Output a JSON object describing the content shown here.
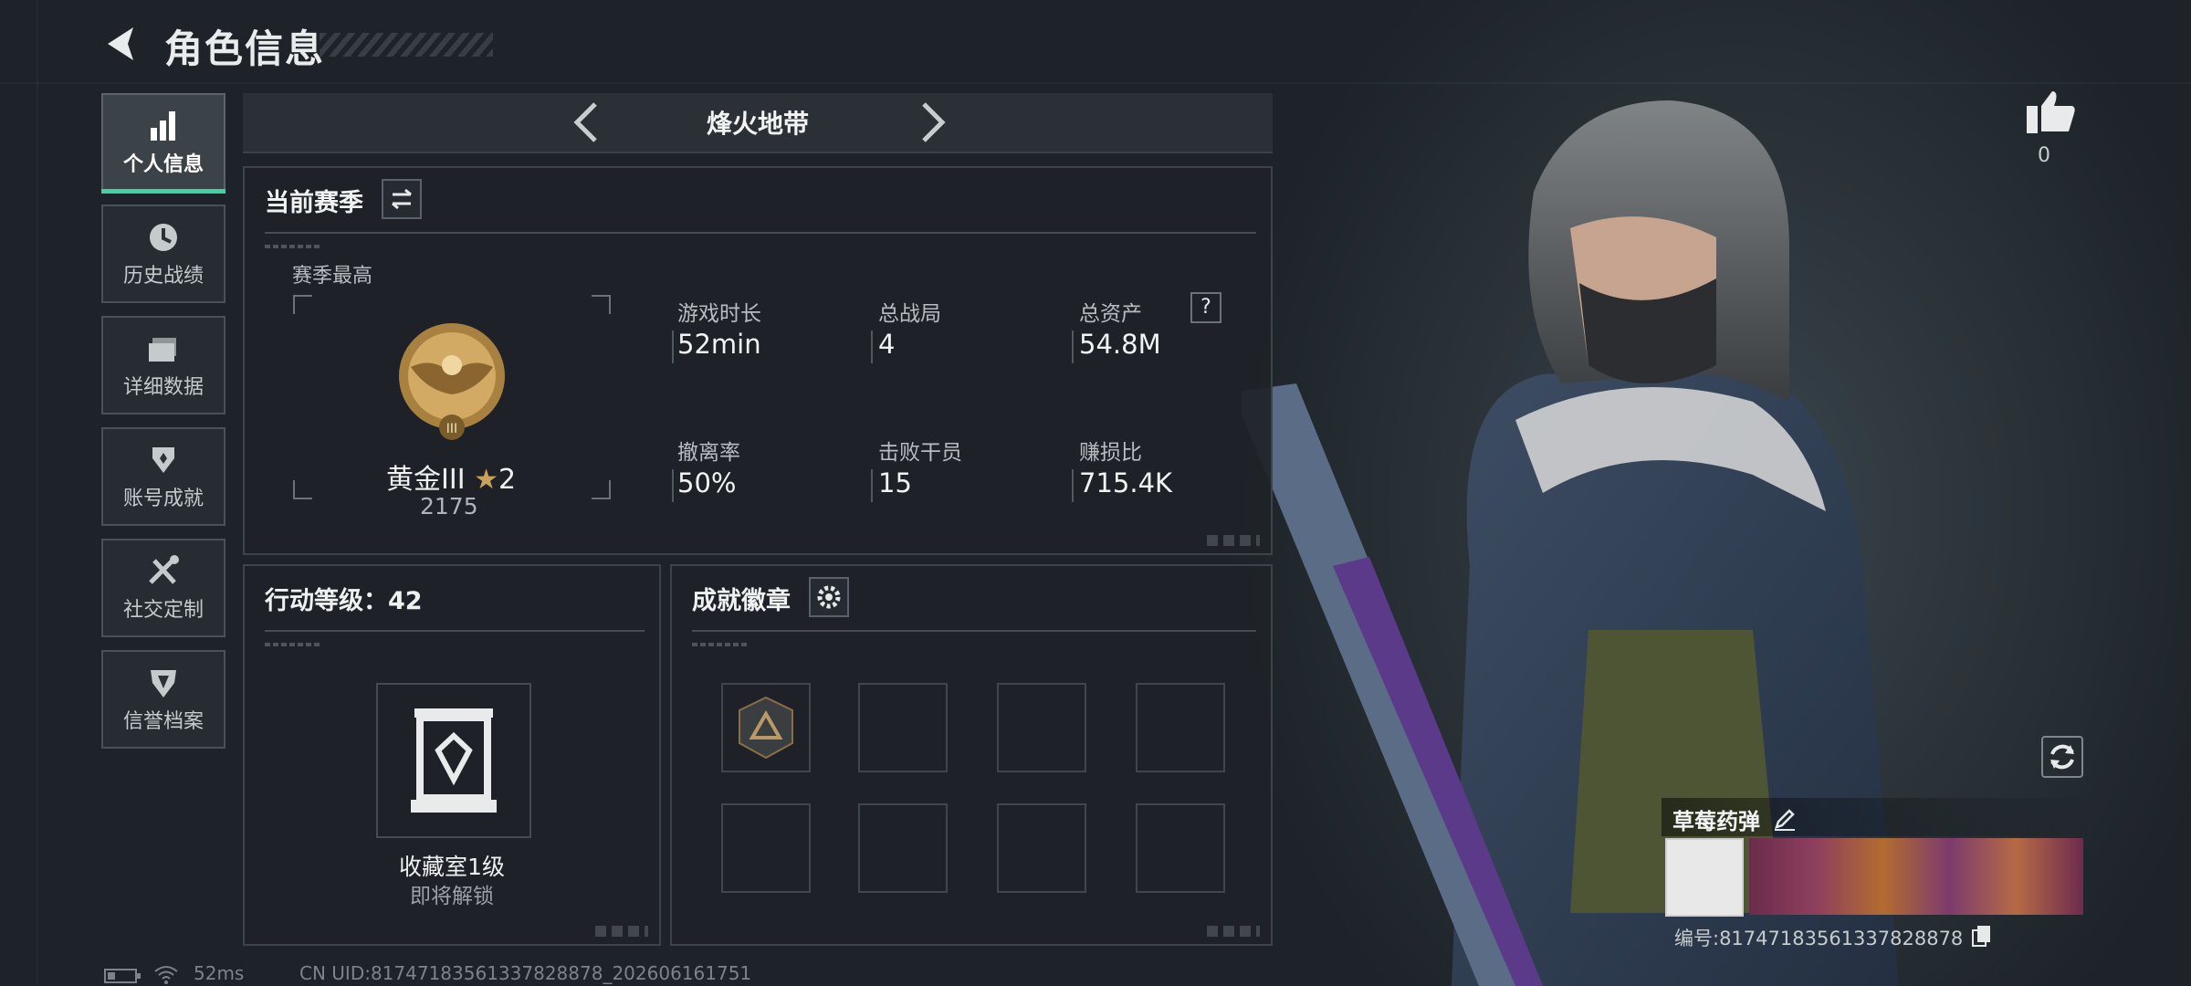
{
  "header": {
    "title": "角色信息"
  },
  "sidebar": {
    "items": [
      {
        "label": "个人信息",
        "icon": "bar-chart-icon",
        "active": true
      },
      {
        "label": "历史战绩",
        "icon": "history-clock-icon"
      },
      {
        "label": "详细数据",
        "icon": "folder-icon"
      },
      {
        "label": "账号成就",
        "icon": "achievement-icon"
      },
      {
        "label": "社交定制",
        "icon": "tools-icon"
      },
      {
        "label": "信誉档案",
        "icon": "shield-icon"
      }
    ]
  },
  "mode": {
    "name": "烽火地带"
  },
  "season": {
    "title": "当前赛季",
    "best_label": "赛季最高",
    "rank_name": "黄金III",
    "rank_stars": "2",
    "rank_score": "2175",
    "stats": [
      {
        "label": "游戏时长",
        "value": "52min"
      },
      {
        "label": "总战局",
        "value": "4"
      },
      {
        "label": "总资产",
        "value": "54.8M"
      },
      {
        "label": "撤离率",
        "value": "50%"
      },
      {
        "label": "击败干员",
        "value": "15"
      },
      {
        "label": "赚损比",
        "value": "715.4K"
      }
    ],
    "help_icon": "?"
  },
  "action_level": {
    "title": "行动等级：42",
    "collection_name": "收藏室1级",
    "collection_status": "即将解锁"
  },
  "badges": {
    "title": "成就徽章"
  },
  "profile": {
    "likes": "0",
    "nickname": "草莓药弹",
    "id_text": "编号:817471835613378288​78"
  },
  "status_bar": {
    "ping": "52ms",
    "uid": "CN UID:817471835613378288​78_202606161751"
  },
  "colors": {
    "accent": "#3fd3a3",
    "gold": "#c9a25a"
  }
}
